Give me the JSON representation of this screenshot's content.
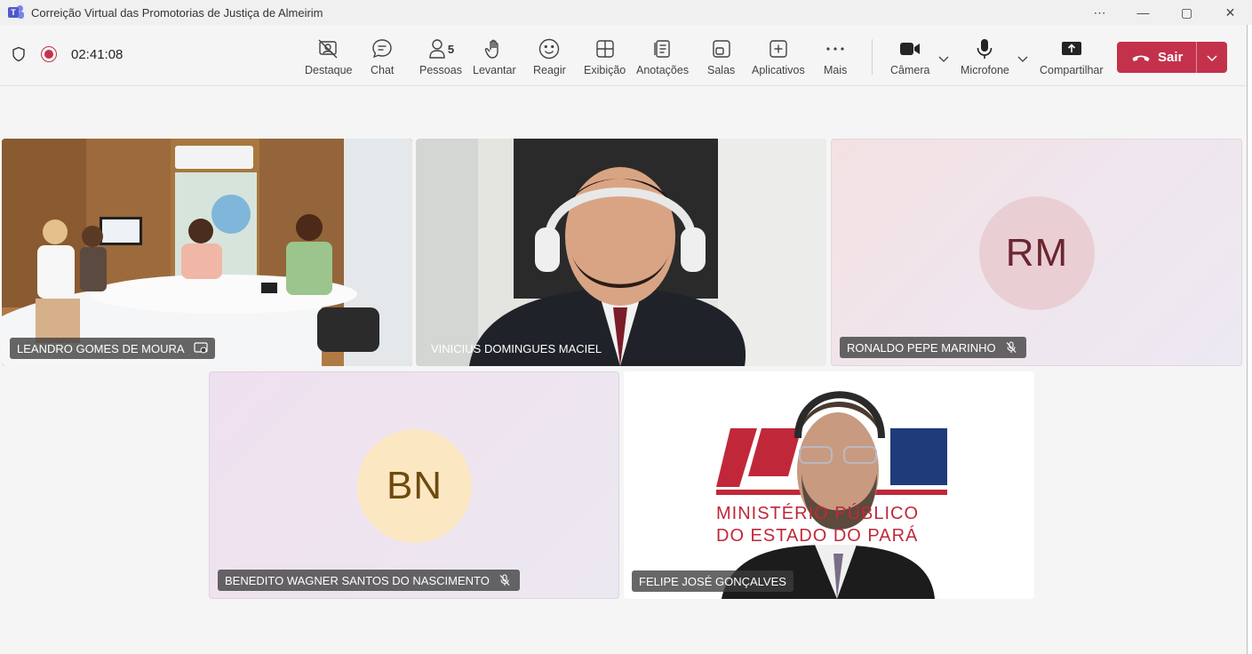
{
  "window": {
    "title": "Correição Virtual das Promotorias de Justiça de Almeirim",
    "more_glyph": "⋯",
    "minimize_glyph": "—",
    "maximize_glyph": "▢",
    "close_glyph": "✕"
  },
  "meeting": {
    "elapsed": "02:41:08",
    "recording": true
  },
  "toolbar": {
    "spotlight": "Destaque",
    "chat": "Chat",
    "people": "Pessoas",
    "people_count": "5",
    "raise": "Levantar",
    "react": "Reagir",
    "view": "Exibição",
    "notes": "Anotações",
    "rooms": "Salas",
    "apps": "Aplicativos",
    "more": "Mais",
    "camera": "Câmera",
    "microphone": "Microfone",
    "share": "Compartilhar",
    "leave": "Sair"
  },
  "participants": [
    {
      "name": "LEANDRO GOMES DE MOURA",
      "type": "video",
      "active_speaker": true,
      "tag_icon": "presenter-icon"
    },
    {
      "name": "VINICIUS DOMINGUES MACIEL",
      "type": "video"
    },
    {
      "name": "RONALDO PEPE MARINHO",
      "type": "avatar",
      "initials": "RM",
      "muted": true,
      "avatar_bg": "#e9cfd3",
      "avatar_fg": "#6b2531"
    },
    {
      "name": "BENEDITO WAGNER SANTOS DO NASCIMENTO",
      "type": "avatar",
      "initials": "BN",
      "muted": true,
      "avatar_bg": "#fbe8c3",
      "avatar_fg": "#6f4a0e"
    },
    {
      "name": "FELIPE JOSÉ GONÇALVES",
      "type": "video",
      "background_text": [
        "MINISTÉRIO PÚBLICO",
        "DO ESTADO DO PARÁ"
      ]
    }
  ],
  "colors": {
    "leave": "#c4314b",
    "record": "#c4314b",
    "brand": "#5059c9"
  }
}
